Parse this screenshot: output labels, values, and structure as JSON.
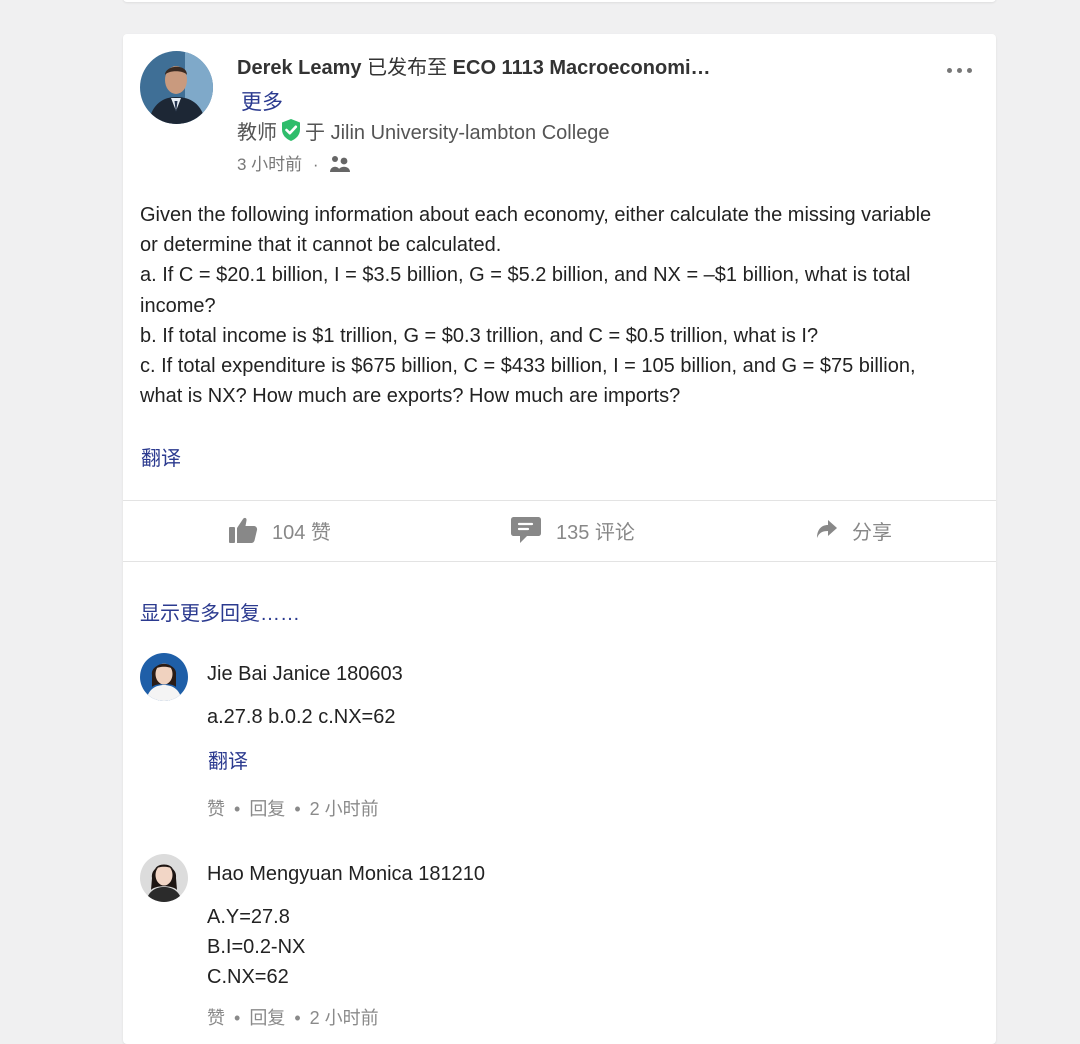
{
  "post": {
    "author": "Derek Leamy",
    "posted_to_label": "已发布至",
    "group_name": "ECO 1113 Macroeconomi…",
    "more_label": "更多",
    "role": "教师",
    "role_connector": "于",
    "institution": "Jilin University-lambton College",
    "time": "3 小时前",
    "meta_separator": "·",
    "body_lines": [
      "Given the following information about each economy, either calculate the missing variable",
      "or determine that it cannot be calculated.",
      "a. If C = $20.1 billion, I = $3.5 billion, G = $5.2 billion, and NX = –$1 billion, what is total",
      "income?",
      "b. If total income is $1 trillion, G = $0.3 trillion, and C = $0.5 trillion, what is I?",
      "c. If total expenditure is $675 billion, C = $433 billion, I = 105 billion, and G = $75 billion,",
      "what is NX? How much are exports? How much are imports?"
    ],
    "translate_label": "翻译"
  },
  "actions": {
    "like": "104 赞",
    "comment": "135 评论",
    "share": "分享"
  },
  "comments_section": {
    "show_more": "显示更多回复……",
    "comments": [
      {
        "name": "Jie Bai Janice 180603",
        "lines": [
          "a.27.8 b.0.2 c.NX=62"
        ],
        "translate_label": "翻译",
        "like_label": "赞",
        "reply_label": "回复",
        "time": "2 小时前"
      },
      {
        "name": "Hao Mengyuan Monica 181210",
        "lines": [
          "A.Y=27.8",
          "B.I=0.2-NX",
          "C.NX=62"
        ],
        "like_label": "赞",
        "reply_label": "回复",
        "time": "2 小时前"
      }
    ],
    "bullet": "•"
  },
  "colors": {
    "link": "#2b3a8f",
    "verified": "#2ebd6b",
    "muted": "#888888",
    "background": "#f0f0f1"
  },
  "icons": [
    "ellipsis-icon",
    "verified-check-icon",
    "group-visibility-icon",
    "thumbs-up-icon",
    "comment-icon",
    "share-arrow-icon"
  ]
}
